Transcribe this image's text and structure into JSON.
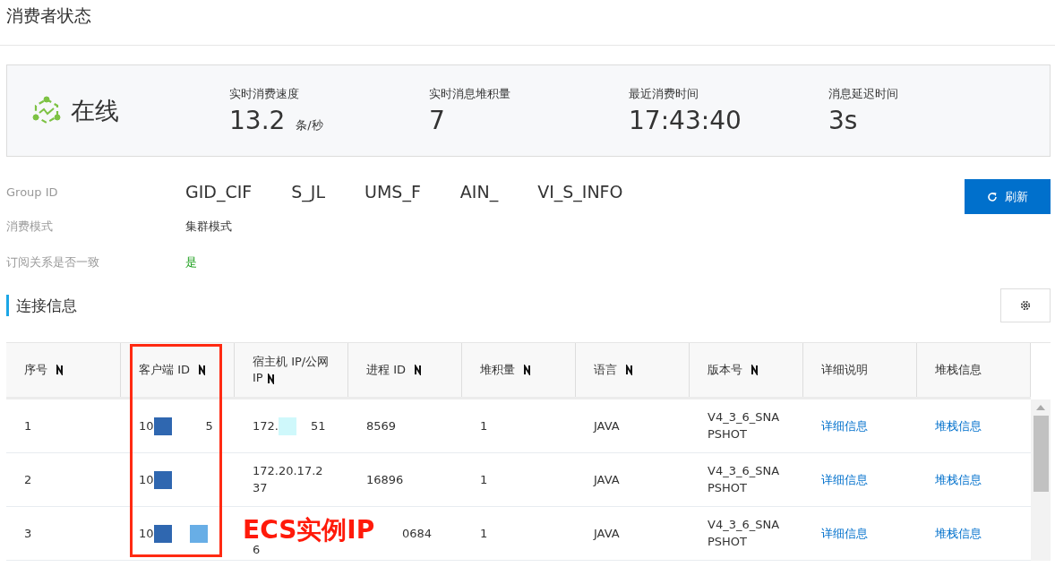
{
  "page_title": "消费者状态",
  "status": {
    "label": "在线",
    "online": true
  },
  "metrics": [
    {
      "label": "实时消费速度",
      "value": "13.2",
      "unit": "条/秒"
    },
    {
      "label": "实时消息堆积量",
      "value": "7"
    },
    {
      "label": "最近消费时间",
      "value": "17:43:40"
    },
    {
      "label": "消息延迟时间",
      "value": "3s"
    }
  ],
  "info": [
    {
      "label": "Group ID",
      "value_fragments": [
        "GID_CIF",
        "S_JL",
        "UMS_F",
        "AIN_",
        "VI_S_INFO"
      ],
      "kind": "fragments"
    },
    {
      "label": "消费模式",
      "value": "集群模式",
      "kind": "plain"
    },
    {
      "label": "订阅关系是否一致",
      "value": "是",
      "kind": "ok"
    }
  ],
  "refresh_button": "刷新",
  "section_title": "连接信息",
  "table": {
    "columns": [
      {
        "label": "序号",
        "sortable": true
      },
      {
        "label": "客户端 ID",
        "sortable": true
      },
      {
        "label": "宿主机 IP/公网 IP",
        "sortable": true
      },
      {
        "label": "进程 ID",
        "sortable": true
      },
      {
        "label": "堆积量",
        "sortable": true
      },
      {
        "label": "语言",
        "sortable": true
      },
      {
        "label": "版本号",
        "sortable": true
      },
      {
        "label": "详细说明",
        "sortable": false
      },
      {
        "label": "堆栈信息",
        "sortable": false
      }
    ],
    "rows": [
      {
        "index": "1",
        "client_id": [
          "10",
          "5"
        ],
        "host_ip": [
          "172.",
          "51"
        ],
        "pid": "8569",
        "backlog": "1",
        "language": "JAVA",
        "version": "V4_3_6_SNAPSHOT",
        "detail": "详细信息",
        "stack": "堆栈信息"
      },
      {
        "index": "2",
        "client_id": [
          "10"
        ],
        "host_ip": [
          "172.20.17.237"
        ],
        "pid": "16896",
        "backlog": "1",
        "language": "JAVA",
        "version": "V4_3_6_SNAPSHOT",
        "detail": "详细信息",
        "stack": "堆栈信息"
      },
      {
        "index": "3",
        "client_id": [
          "10"
        ],
        "host_ip": [
          "6"
        ],
        "pid": "0684",
        "backlog": "1",
        "language": "JAVA",
        "version": "V4_3_6_SNAPSHOT",
        "detail": "详细信息",
        "stack": "堆栈信息"
      }
    ]
  },
  "annotation": "ECS实例IP"
}
